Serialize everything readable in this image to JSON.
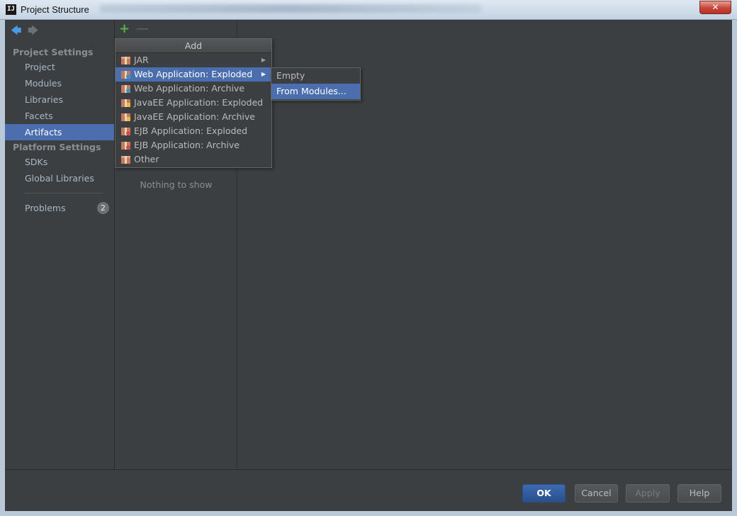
{
  "window": {
    "title": "Project Structure",
    "close_label": "✕",
    "logo_text": "IJ"
  },
  "sidebar": {
    "sections": [
      {
        "header": "Project Settings",
        "items": [
          "Project",
          "Modules",
          "Libraries",
          "Facets",
          "Artifacts"
        ]
      },
      {
        "header": "Platform Settings",
        "items": [
          "SDKs",
          "Global Libraries"
        ]
      }
    ],
    "selected_item": "Artifacts",
    "problems": {
      "label": "Problems",
      "count": "2"
    }
  },
  "artifacts_panel": {
    "empty_text": "Nothing to show"
  },
  "add_menu": {
    "title": "Add",
    "items": [
      {
        "label": "JAR",
        "has_submenu": true
      },
      {
        "label": "Web Application: Exploded",
        "has_submenu": true,
        "selected": true
      },
      {
        "label": "Web Application: Archive"
      },
      {
        "label": "JavaEE Application: Exploded"
      },
      {
        "label": "JavaEE Application: Archive"
      },
      {
        "label": "EJB Application: Exploded"
      },
      {
        "label": "EJB Application: Archive"
      },
      {
        "label": "Other"
      }
    ]
  },
  "submenu": {
    "items": [
      {
        "label": "Empty"
      },
      {
        "label": "From Modules...",
        "selected": true
      }
    ]
  },
  "footer": {
    "ok_label": "OK",
    "cancel_label": "Cancel",
    "apply_label": "Apply",
    "help_label": "Help"
  },
  "colors": {
    "background": "#3c3f41",
    "selection": "#4b6eaf",
    "add_green": "#55b24a",
    "nav_blue": "#4a9be0"
  }
}
